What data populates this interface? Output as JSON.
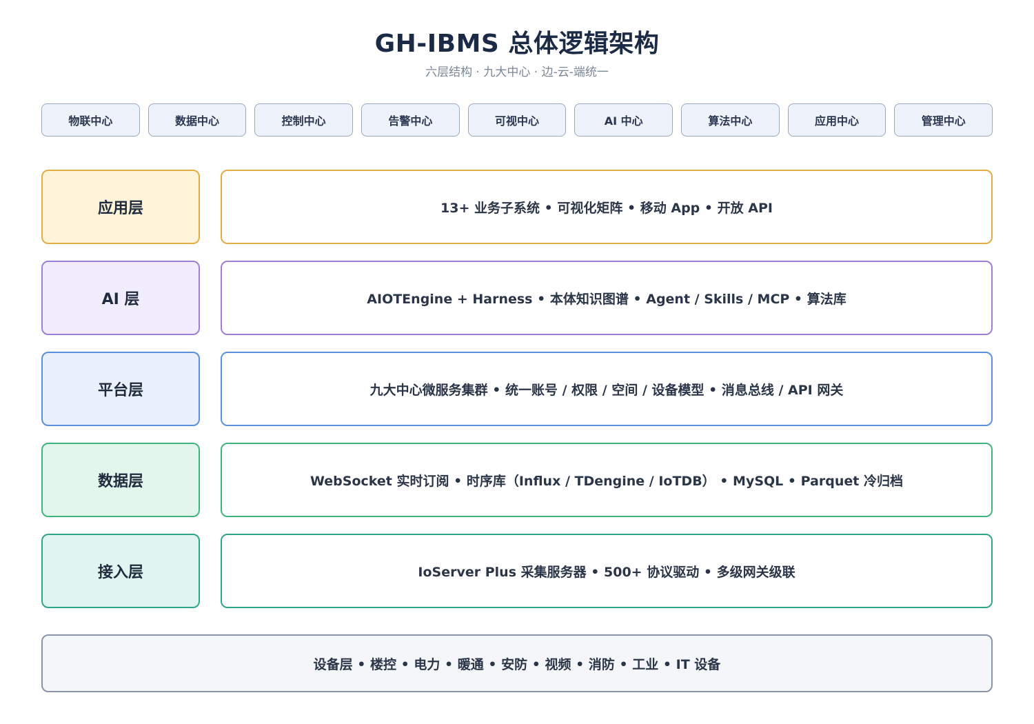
{
  "header": {
    "title": "GH-IBMS 总体逻辑架构",
    "subtitle": "六层结构 · 九大中心 · 边-云-端统一"
  },
  "centers": [
    "物联中心",
    "数据中心",
    "控制中心",
    "告警中心",
    "可视中心",
    "AI 中心",
    "算法中心",
    "应用中心",
    "管理中心"
  ],
  "layers": [
    {
      "label": "应用层",
      "content": "13+ 业务子系统 • 可视化矩阵 • 移动 App • 开放 API",
      "border_color": "#e3ad45",
      "fill_color": "#fdf3d9"
    },
    {
      "label": "AI 层",
      "content": "AIOTEngine + Harness • 本体知识图谱 • Agent / Skills / MCP • 算法库",
      "border_color": "#9b7fd8",
      "fill_color": "#f1edfc"
    },
    {
      "label": "平台层",
      "content": "九大中心微服务集群 • 统一账号 / 权限 / 空间 / 设备模型 • 消息总线 / API 网关",
      "border_color": "#5b8fe0",
      "fill_color": "#eaf1fd"
    },
    {
      "label": "数据层",
      "content": "WebSocket 实时订阅 • 时序库（Influx / TDengine / IoTDB） • MySQL • Parquet 冷归档",
      "border_color": "#3fb57d",
      "fill_color": "#e3f6ec"
    },
    {
      "label": "接入层",
      "content": "IoServer Plus 采集服务器 • 500+ 协议驱动 • 多级网关级联",
      "border_color": "#2fa68a",
      "fill_color": "#e0f5f0"
    }
  ],
  "device_layer": {
    "text": "设备层 • 楼控 • 电力 • 暖通 • 安防 • 视频 • 消防 • 工业 • IT 设备",
    "border_color": "#8a94a6",
    "fill_color": "#f4f6f9"
  }
}
